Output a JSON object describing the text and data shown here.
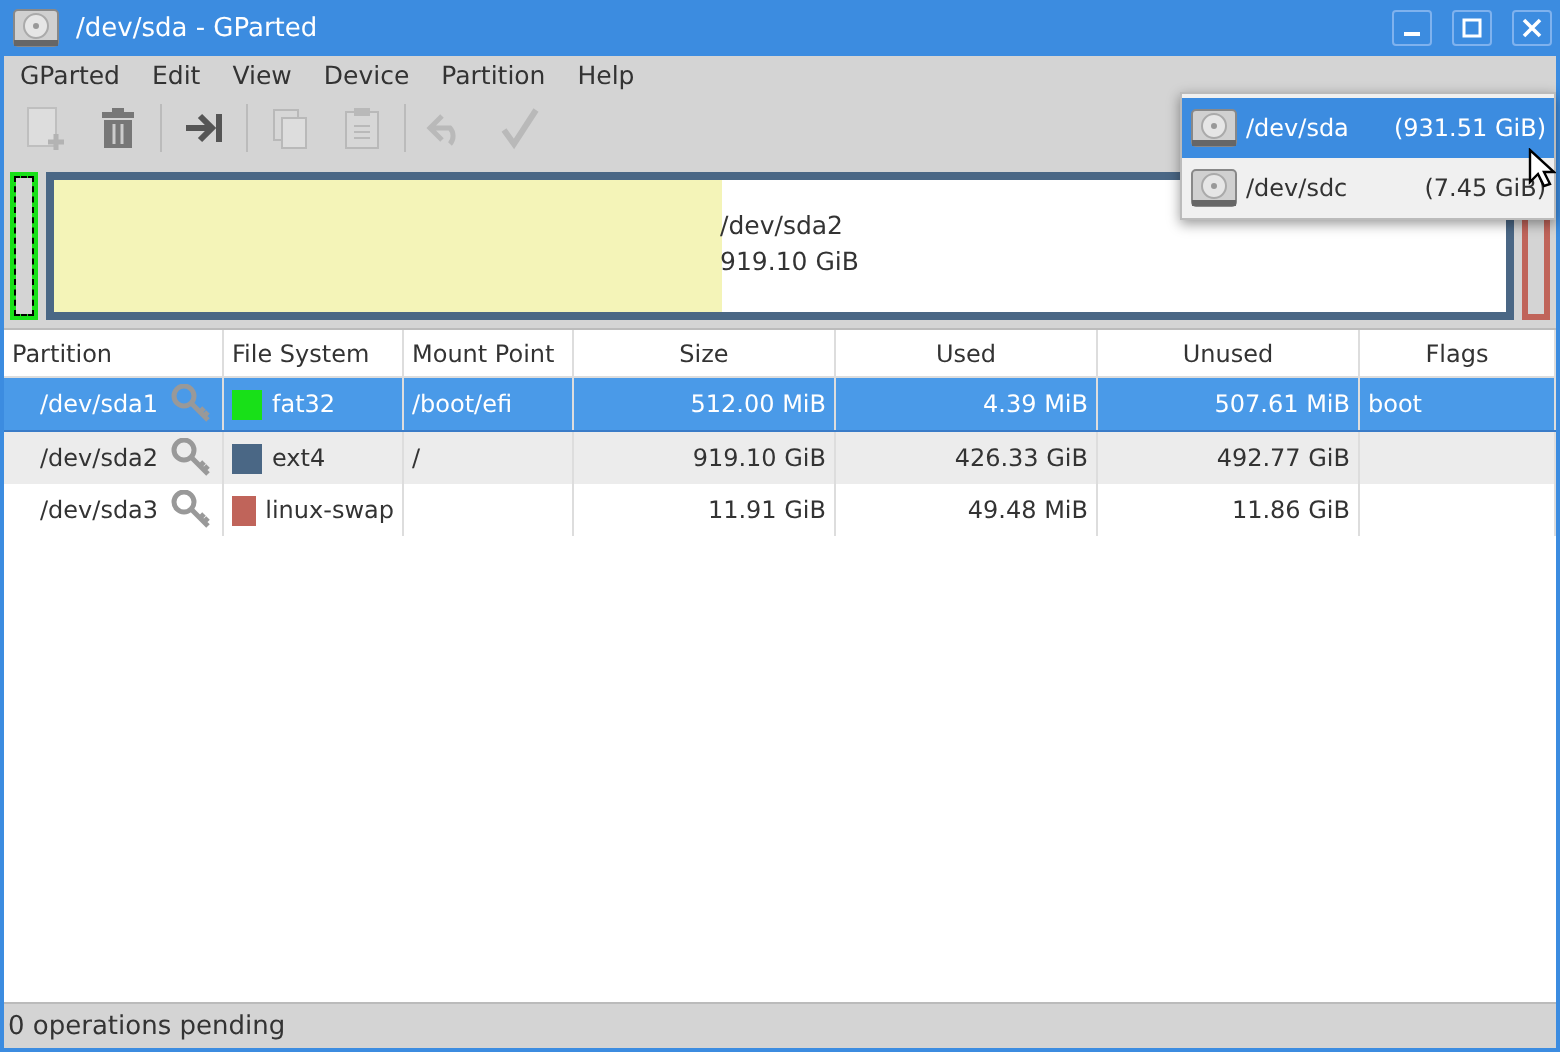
{
  "window": {
    "title": "/dev/sda - GParted"
  },
  "menu": [
    "GParted",
    "Edit",
    "View",
    "Device",
    "Partition",
    "Help"
  ],
  "toolbar": [
    {
      "kind": "new",
      "disabled": true
    },
    {
      "kind": "delete",
      "disabled": false
    },
    {
      "kind": "sep"
    },
    {
      "kind": "resize",
      "disabled": false
    },
    {
      "kind": "sep"
    },
    {
      "kind": "copy",
      "disabled": true
    },
    {
      "kind": "paste",
      "disabled": true
    },
    {
      "kind": "sep"
    },
    {
      "kind": "undo",
      "disabled": true
    },
    {
      "kind": "apply",
      "disabled": true
    }
  ],
  "partition_map": [
    {
      "kind": "small",
      "color": "#18e018",
      "selected": true
    },
    {
      "kind": "main",
      "color": "#4a6785",
      "name": "/dev/sda2",
      "size": "919.10 GiB",
      "level": 0.46,
      "selected": false
    },
    {
      "kind": "small",
      "color": "#c0645a",
      "selected": false
    }
  ],
  "device_menu": [
    {
      "name": "/dev/sda",
      "size": "(931.51 GiB)",
      "selected": true
    },
    {
      "name": "/dev/sdc",
      "size": "(7.45 GiB)",
      "selected": false
    }
  ],
  "table": {
    "columns": [
      "Partition",
      "File System",
      "Mount Point",
      "Size",
      "Used",
      "Unused",
      "Flags"
    ],
    "rows": [
      {
        "partition": "/dev/sda1",
        "color": "#18e018",
        "file_system": "fat32",
        "mount_point": "/boot/efi",
        "size": "512.00 MiB",
        "used": "4.39 MiB",
        "unused": "507.61 MiB",
        "flags": "boot",
        "selected": true
      },
      {
        "partition": "/dev/sda2",
        "color": "#4a6785",
        "file_system": "ext4",
        "mount_point": "/",
        "size": "919.10 GiB",
        "used": "426.33 GiB",
        "unused": "492.77 GiB",
        "flags": "",
        "selected": false
      },
      {
        "partition": "/dev/sda3",
        "color": "#c0645a",
        "file_system": "linux-swap",
        "mount_point": "",
        "size": "11.91 GiB",
        "used": "49.48 MiB",
        "unused": "11.86 GiB",
        "flags": "",
        "selected": false
      }
    ]
  },
  "status_bar": "0 operations pending"
}
